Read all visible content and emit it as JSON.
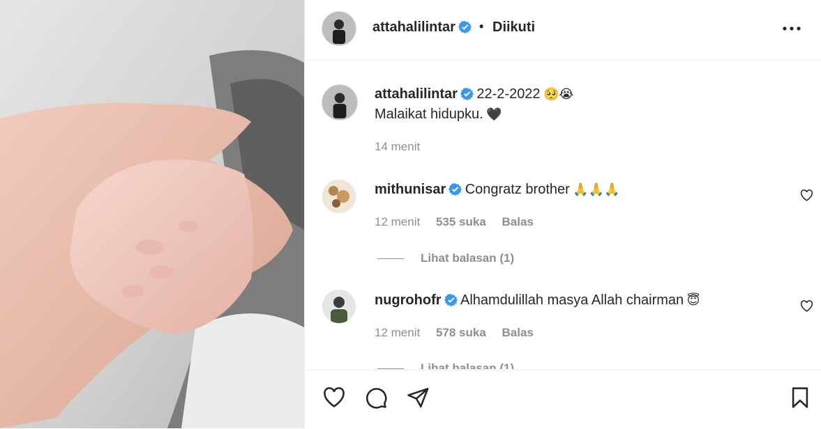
{
  "post": {
    "author": "attahalilintar",
    "follow_status": "Diikuti",
    "separator": "•"
  },
  "caption": {
    "author": "attahalilintar",
    "text_date": "22-2-2022",
    "emoji": "🥺😭",
    "text_line2": "Malaikat hidupku.",
    "heart": "🖤",
    "time": "14 menit"
  },
  "comments": [
    {
      "author": "mithunisar",
      "text": "Congratz brother",
      "emoji": "🙏🙏🙏",
      "time": "12 menit",
      "likes": "535 suka",
      "reply": "Balas",
      "view_replies": "Lihat balasan (1)"
    },
    {
      "author": "nugrohofr",
      "text": "Alhamdulillah masya Allah chairman",
      "emoji": "😇",
      "time": "12 menit",
      "likes": "578 suka",
      "reply": "Balas",
      "view_replies": "Lihat balasan (1)"
    }
  ],
  "icons": {
    "verified": "verified-badge-icon",
    "more": "more-options-icon",
    "like": "heart-icon",
    "comment": "comment-icon",
    "share": "share-icon",
    "save": "bookmark-icon"
  },
  "colors": {
    "verified": "#3897f0",
    "text": "#262626",
    "muted": "#8e8e8e",
    "divider": "#efefef"
  }
}
